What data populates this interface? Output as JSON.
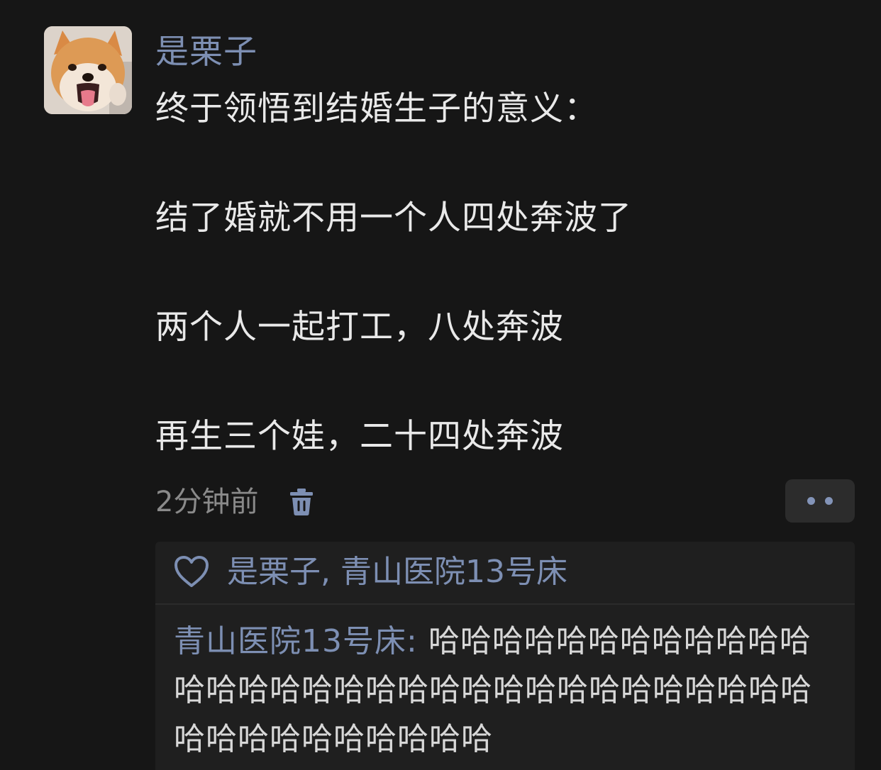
{
  "post": {
    "author": "是栗子",
    "content_lines": [
      "终于领悟到结婚生子的意义：",
      "结了婚就不用一个人四处奔波了",
      "两个人一起打工，八处奔波",
      "再生三个娃，二十四处奔波"
    ],
    "timestamp": "2分钟前",
    "avatar_icon": "shiba-dog-avatar",
    "delete_icon": "trash-icon",
    "more_icon": "more-dots-icon"
  },
  "interactions": {
    "likes_icon": "heart-icon",
    "likes_text": "是栗子, 青山医院13号床",
    "comment": {
      "author": "青山医院13号床",
      "separator": ": ",
      "first_line_text": "哈哈哈哈哈哈哈哈哈哈哈哈",
      "line2": "哈哈哈哈哈哈哈哈哈哈哈哈哈哈哈哈哈哈哈哈",
      "line3": "哈哈哈哈哈哈哈哈哈哈"
    }
  },
  "colors": {
    "background": "#161616",
    "accent": "#7d8fb3",
    "text": "#e9e9e9",
    "muted": "#8a8a8a",
    "panel": "#1f1f1f"
  }
}
